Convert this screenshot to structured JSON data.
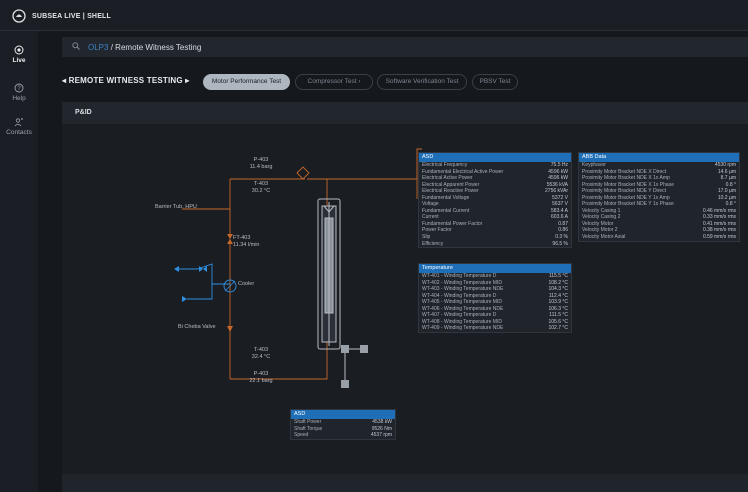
{
  "app": {
    "brand": "SUBSEA LIVE | SHELL"
  },
  "sidebar": {
    "items": [
      {
        "label": "Live",
        "icon": "live-icon"
      },
      {
        "label": "Help",
        "icon": "help-icon"
      },
      {
        "label": "Contacts",
        "icon": "contacts-icon"
      }
    ]
  },
  "breadcrumb": {
    "link": "OLP3",
    "separator": "/",
    "current": "Remote Witness Testing"
  },
  "section": {
    "title": "REMOTE WITNESS TESTING"
  },
  "tabs": [
    {
      "label": "Motor Performance Test",
      "active": true
    },
    {
      "label": "Compressor Test"
    },
    {
      "label": "Software Verification Test"
    },
    {
      "label": "PBSV Test"
    }
  ],
  "pid": {
    "title": "P&ID",
    "labels": {
      "pt_top_tag": "P-403",
      "pt_top_val": "11.4 barg",
      "tt_top_tag": "T-403",
      "tt_top_val": "30.2 °C",
      "barrier": "Barrier Tub. HPU",
      "ft_tag": "FT-403",
      "ft_val": "11.34 l/min",
      "cooler": "Cooler",
      "check_valve": "Bi Cheba Valve",
      "tt_bot_tag": "T-403",
      "tt_bot_val": "32.4 °C",
      "pt_bot_tag": "P-403",
      "pt_bot_val": "22.1 barg"
    },
    "asd_top": {
      "header": "ASD",
      "rows": [
        {
          "k": "Electrical Frequency",
          "v": "75.5 Hz"
        },
        {
          "k": "Fundamental Electrical Active Power",
          "v": "4596 kW"
        },
        {
          "k": "Electrical Active Power",
          "v": "4596 kW"
        },
        {
          "k": "Electrical Apparent Power",
          "v": "5536 kVA"
        },
        {
          "k": "Electrical Reactive Power",
          "v": "2756 kVAr"
        },
        {
          "k": "Fundamental Voltage",
          "v": "5372 V"
        },
        {
          "k": "Voltage",
          "v": "5637 V"
        },
        {
          "k": "Fundamental Current",
          "v": "583.4 A"
        },
        {
          "k": "Current",
          "v": "603.6 A"
        },
        {
          "k": "Fundamental Power Factor",
          "v": "0.87"
        },
        {
          "k": "Power Factor",
          "v": "0.86"
        },
        {
          "k": "Slip",
          "v": "0.3 %"
        },
        {
          "k": "Efficiency",
          "v": "96.5 %"
        }
      ]
    },
    "temperature": {
      "header": "Temperature",
      "rows": [
        {
          "k": "WT-401 - Winding Temperature D",
          "v": "115.5 °C"
        },
        {
          "k": "WT-402 - Winding Temperature MID",
          "v": "108.2 °C"
        },
        {
          "k": "WT-403 - Winding Temperature NDE",
          "v": "104.3 °C"
        },
        {
          "k": "WT-404 - Winding Temperature D",
          "v": "112.4 °C"
        },
        {
          "k": "WT-405 - Winding Temperature MID",
          "v": "103.9 °C"
        },
        {
          "k": "WT-406 - Winding Temperature NDE",
          "v": "106.3 °C"
        },
        {
          "k": "WT-407 - Winding Temperature D",
          "v": "111.5 °C"
        },
        {
          "k": "WT-408 - Winding Temperature MID",
          "v": "105.6 °C"
        },
        {
          "k": "WT-409 - Winding Temperature NDE",
          "v": "102.7 °C"
        }
      ]
    },
    "abb_data": {
      "header": "ABB Data",
      "rows": [
        {
          "k": "Keyphasor",
          "v": "4530 rpm"
        },
        {
          "k": "Proximity Motor Bracket NDE X Direct",
          "v": "14.6 µm"
        },
        {
          "k": "Proximity Motor Bracket NDE X 1x Amp",
          "v": "8.7 µm"
        },
        {
          "k": "Proximity Motor Bracket NDE X 1x Phase",
          "v": "0.8 °"
        },
        {
          "k": "Proximity Motor Bracket NDE Y Direct",
          "v": "17.0 µm"
        },
        {
          "k": "Proximity Motor Bracket NDE Y 1x Amp",
          "v": "10.2 µm"
        },
        {
          "k": "Proximity Motor Bracket NDE Y 1x Phase",
          "v": "0.8 °"
        },
        {
          "k": "Velocity Casing 1",
          "v": "0.46 mm/s rms"
        },
        {
          "k": "Velocity Casing 2",
          "v": "0.33 mm/s rms"
        },
        {
          "k": "Velocity Motor",
          "v": "0.41 mm/s rms"
        },
        {
          "k": "Velocity Motor 2",
          "v": "0.38 mm/s rms"
        },
        {
          "k": "Velocity Motor Axial",
          "v": "0.59 mm/s rms"
        }
      ]
    },
    "asd_bottom": {
      "header": "ASD",
      "rows": [
        {
          "k": "Shaft Power",
          "v": "4538 kW"
        },
        {
          "k": "Shaft Torque",
          "v": "9526 Nm"
        },
        {
          "k": "Speed",
          "v": "4537 rpm"
        }
      ]
    }
  }
}
